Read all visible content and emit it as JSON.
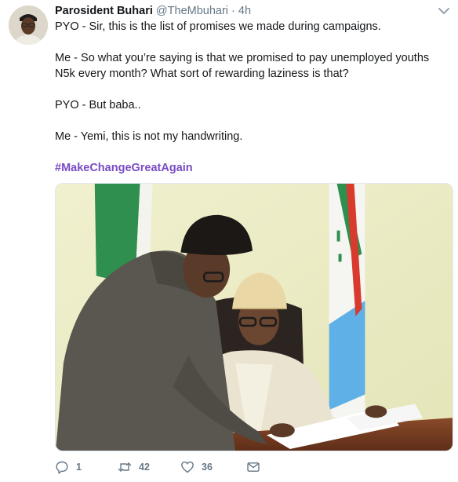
{
  "tweet": {
    "display_name": "Parosident Buhari",
    "handle": "@TheMbuhari",
    "separator": "·",
    "time": "4h",
    "paragraphs": [
      "PYO - Sir, this is the list of promises we made during campaigns.",
      "Me - So what you’re saying is that we promised to pay unemployed youths N5k every month? What sort of rewarding laziness is that?",
      "PYO - But baba..",
      "Me - Yemi, this is not my handwriting."
    ],
    "hashtag": "#MakeChangeGreatAgain"
  },
  "actions": {
    "reply_count": "1",
    "retweet_count": "42",
    "like_count": "36"
  },
  "icons": {
    "caret": "chevron-down-icon",
    "reply": "reply-icon",
    "retweet": "retweet-icon",
    "like": "heart-icon",
    "dm": "envelope-icon"
  },
  "colors": {
    "text": "#14171a",
    "muted": "#657786",
    "hashtag": "#794bc4",
    "border": "#e1e8ed"
  }
}
